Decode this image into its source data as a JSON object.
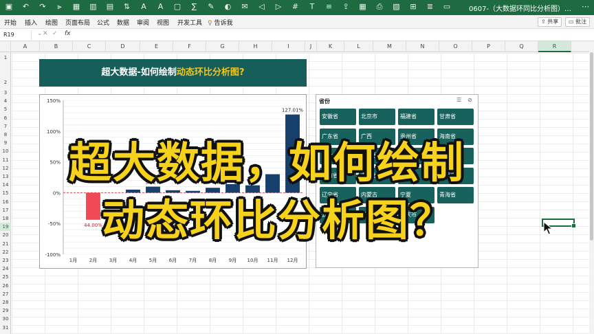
{
  "app": {
    "doc_title": "0607-（大数据环同比分析图）…",
    "accent": "#1e6b41"
  },
  "toolbar_icons": [
    "save-icon",
    "undo-icon",
    "redo-icon",
    "filter-icon",
    "table-icon",
    "chart-icon",
    "fill-icon",
    "sort-icon",
    "font-grow-icon",
    "font-shrink-icon",
    "border-icon",
    "sum-icon",
    "format-painter-icon",
    "paint-icon",
    "comment-icon",
    "decrease-icon",
    "increase-icon",
    "number-icon",
    "text-icon",
    "list-icon",
    "share-icon",
    "grid-icon",
    "print-icon",
    "image-icon",
    "pivot-icon",
    "calc-icon",
    "window-icon"
  ],
  "ribbon": {
    "tabs": [
      "开始",
      "插入",
      "绘图",
      "页面布局",
      "公式",
      "数据",
      "审阅",
      "视图",
      "开发工具",
      "告诉我"
    ],
    "share_label": "共享",
    "comment_label": "批注"
  },
  "formula_bar": {
    "name_box": "R19",
    "fx_label": "fx",
    "value": ""
  },
  "columns": [
    "A",
    "B",
    "C",
    "D",
    "E",
    "F",
    "G",
    "H",
    "I",
    "J",
    "K",
    "L",
    "M",
    "N",
    "O",
    "P",
    "Q",
    "R"
  ],
  "selected_column": "R",
  "rows": [
    "1",
    "2",
    "3",
    "4",
    "5",
    "6",
    "7",
    "8",
    "9",
    "10",
    "11",
    "12",
    "13",
    "14",
    "15",
    "16",
    "17",
    "18",
    "19",
    "20",
    "21",
    "22",
    "23",
    "24",
    "25",
    "26",
    "27",
    "28",
    "29",
    "30",
    "31",
    "32",
    "33"
  ],
  "selected_row": "19",
  "heading": {
    "part1": "超大数据-如何绘制",
    "part2": "动态环比分析图?"
  },
  "chart_data": {
    "type": "bar",
    "categories": [
      "1月",
      "2月",
      "3月",
      "4月",
      "5月",
      "6月",
      "7月",
      "8月",
      "9月",
      "10月",
      "11月",
      "12月"
    ],
    "values": [
      null,
      -44.0,
      null,
      5,
      9.82,
      4,
      3,
      8,
      14,
      12,
      30,
      127.01
    ],
    "data_labels": [
      "",
      "44.00%",
      "",
      "",
      "9.82%",
      "",
      "",
      "",
      "",
      "",
      "",
      "127.01%"
    ],
    "y_ticks": [
      "150%",
      "100%",
      "50%",
      "0%",
      "-50%",
      "-100%"
    ],
    "ylim": [
      -100,
      150
    ],
    "positive_color": "#173f6b",
    "negative_color": "#f04a56",
    "grid": true
  },
  "slicer": {
    "title": "省份",
    "items": [
      "安徽省",
      "北京市",
      "福建省",
      "甘肃省",
      "广东省",
      "广西",
      "贵州省",
      "海南省",
      "河北省",
      "河南省",
      "黑龙江",
      "湖北省",
      "湖南省",
      "吉林省",
      "江苏省",
      "江西省",
      "辽宁省",
      "内蒙古",
      "宁夏",
      "青海省",
      "云南省",
      "浙江省",
      "重庆市"
    ]
  },
  "overlay": {
    "line1": "超大数据，如何绘制",
    "line2": "动态环比分析图？"
  }
}
